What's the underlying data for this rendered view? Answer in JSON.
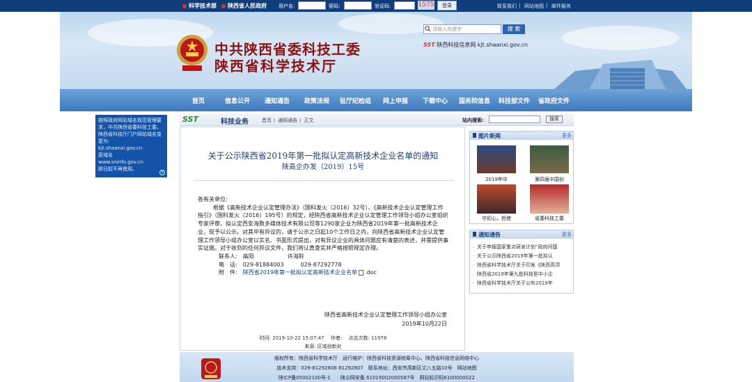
{
  "topbar": {
    "link1": "科学技术部",
    "link2": "陕西省人民政府",
    "username_label": "用户名:",
    "password_label": "密码:",
    "captcha_label": "验证码:",
    "captcha_value": "1575",
    "login_button": "登录",
    "right_links": [
      "联系我们",
      "网站地图",
      "邮件服务"
    ],
    "separator": "|"
  },
  "banner": {
    "title_line1": "中共陕西省委科技工委",
    "title_line2": "陕西省科学技术厅",
    "search_placeholder": "请输入关键字",
    "search_button": "搜 索",
    "sst_brand": "SST",
    "sst_text": "陕西科技信息网 kjt.shaanxi.gov.cn"
  },
  "nav": {
    "items": [
      "首页",
      "信息公开",
      "通知通告",
      "政策法规",
      "驻厅纪检组",
      "网上申报",
      "下载中心",
      "国务院信息",
      "科技部文件",
      "省政府文件"
    ]
  },
  "notice": {
    "text": "按照政府网站域名规范管理要求，中共陕西省委科技工委、陕西省科技厅门户网站域名变更为:",
    "domain_new": "kjt.shaanxi.gov.cn",
    "old_label": "原域名",
    "domain_old": "www.sninfo.gov.cn",
    "footer": "即日起不再使用。",
    "close": "×"
  },
  "crumb": {
    "badge": "SST",
    "section": "科技业务",
    "path": "首页 〉通知通告 〉正文",
    "site_search_label": "站内搜索:",
    "site_search_button": "搜索"
  },
  "article": {
    "title": "关于公示陕西省2019年第一批拟认定高新技术企业名单的通知",
    "doc_no": "陕高企办发（2019）15号",
    "greeting": "各有关单位:",
    "body": "根据《高新技术企业认定管理办法》（国科发火〔2016〕32号）、《高新技术企业认定管理工作指引》（国科发火〔2016〕195号）的规定，经陕西省高新技术企业认定管理工作领导小组办公室组织专家评审，拟认定西安海数多媒体技术有限公司等1290家企业为陕西省2019年第一批高新技术企业，现予以公示。对其中有异议的，请于公示之日起10个工作日之内，向陕西省高新技术企业认定管理工作领导小组办公室以实名、书面形式提出，对有异议企业的具体问题应有清楚的表述，并需提供事实证据。对于收到的任何异议文件，我们将认真查实并严格按照规定办理。",
    "contact_label": "联系人:",
    "contact_names": "高阳　　　　　　许海聆",
    "phone_label": "电　话:",
    "phones": "029-81884003　　　029-87292778",
    "attach_label": "附　件:",
    "attachment": "陕西省2019年第一批拟认定高新技术企业名单",
    "attachment_ext": ".doc",
    "signoff_org": "陕西省高新技术企业认定管理工作领导小组办公室",
    "signoff_date": "2019年10月22日",
    "time_label": "时间:",
    "time_value": "2019-10-22 15:07:47",
    "author_label": "作者:",
    "clicks_label": "点击次数:",
    "clicks_value": "11978",
    "source_label": "来源:",
    "source_value": "区域创新处"
  },
  "photo_news": {
    "title": "图片新闻",
    "more": "更多",
    "captions": [
      "2019年中",
      "第四届中国创",
      "守初心，担使",
      "省委科技工委"
    ]
  },
  "notices": {
    "title": "通知通告",
    "more": "更多",
    "items": [
      "关于申报国家重点研发计划“政府间国",
      "关于公示陕西省2019年第一批拟认",
      "陕西省科学技术厅关于印发《陕西高顶",
      "陕西省2019年第九批科技型中小企",
      "陕西省科学技术厅关于公布2019年"
    ]
  },
  "footer": {
    "line1": "版权所有：陕西省科学技术厅　运行维护：陕西省科技资源统筹中心、陕西省科技信息网络中心",
    "line2": "技术支持：029-81292806 81292807　联系地址：西安市高新区丈八五路10号　网站地图",
    "line3": "陕ICP备05002100号-1　　陕公网安备 61019002000587号　网站标识码6100000022"
  },
  "colors": {
    "topbar": "#0f3c7a",
    "nav": "#3c79bf",
    "title_red": "#8a1414",
    "link_blue": "#1c3e77"
  }
}
